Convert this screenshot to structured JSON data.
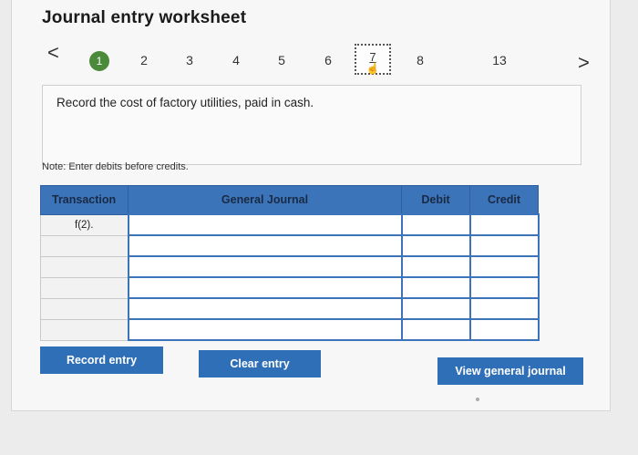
{
  "header": {
    "title": "Journal entry worksheet"
  },
  "stepper": {
    "prev_label": "<",
    "next_label": ">",
    "steps": [
      "1",
      "2",
      "3",
      "4",
      "5",
      "6",
      "7",
      "8",
      "13"
    ],
    "active_step": "1",
    "current_step": "7",
    "colors": {
      "active": "#4b8a3a"
    }
  },
  "prompt": {
    "text": "Record the cost of factory utilities, paid in cash."
  },
  "note": {
    "text": "Note: Enter debits before credits."
  },
  "table": {
    "headers": {
      "transaction": "Transaction",
      "general_journal": "General Journal",
      "debit": "Debit",
      "credit": "Credit"
    },
    "rows": [
      {
        "transaction": "f(2).",
        "account": "",
        "debit": "",
        "credit": ""
      },
      {
        "transaction": "",
        "account": "",
        "debit": "",
        "credit": ""
      },
      {
        "transaction": "",
        "account": "",
        "debit": "",
        "credit": ""
      },
      {
        "transaction": "",
        "account": "",
        "debit": "",
        "credit": ""
      },
      {
        "transaction": "",
        "account": "",
        "debit": "",
        "credit": ""
      },
      {
        "transaction": "",
        "account": "",
        "debit": "",
        "credit": ""
      }
    ]
  },
  "buttons": {
    "record_entry": "Record entry",
    "clear_entry": "Clear entry",
    "view_general_journal": "View general journal"
  },
  "theme": {
    "accent": "#2f6fb8",
    "header_blue": "#3c74b9"
  }
}
